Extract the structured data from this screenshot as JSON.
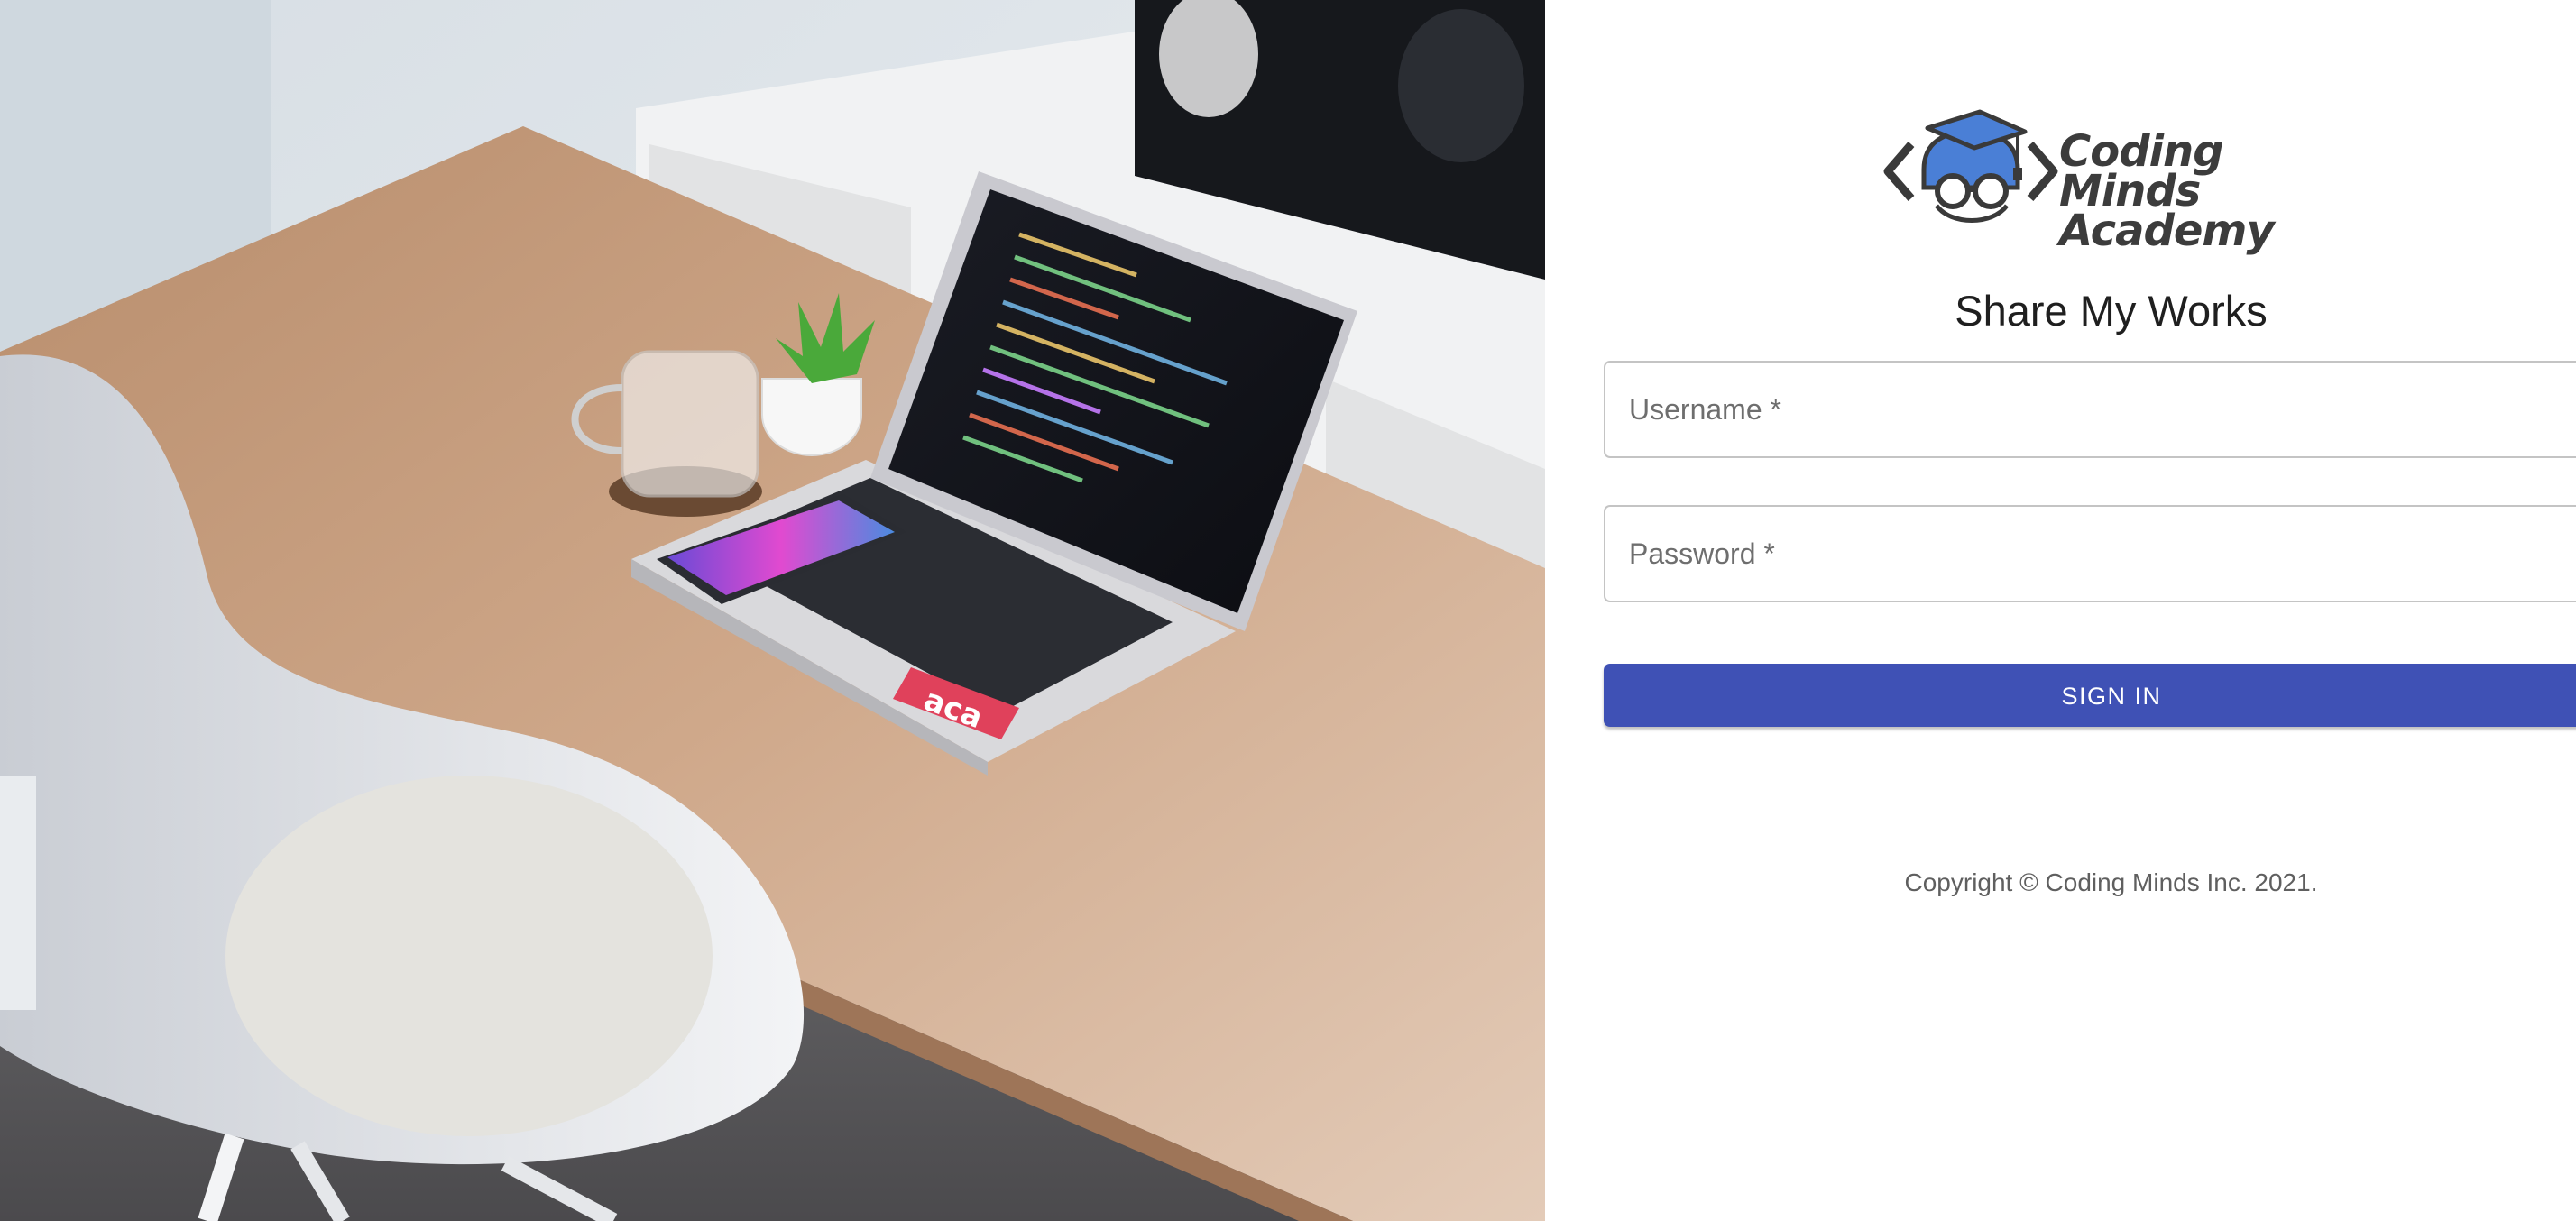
{
  "hero": {
    "description_icon": "desk-laptop-photo",
    "laptop_sticker": "aca"
  },
  "logo": {
    "line1": "Coding Minds",
    "line2": "Academy",
    "icon": "graduate-with-glasses-icon"
  },
  "page": {
    "title": "Share My Works"
  },
  "form": {
    "username_label": "Username *",
    "password_label": "Password *",
    "signin_label": "SIGN IN"
  },
  "footer": {
    "copyright": "Copyright © Coding Minds Inc. 2021."
  },
  "colors": {
    "primary": "#3f51b5",
    "field_border": "#c4c4c4",
    "logo_blue": "#4a7fd6"
  }
}
